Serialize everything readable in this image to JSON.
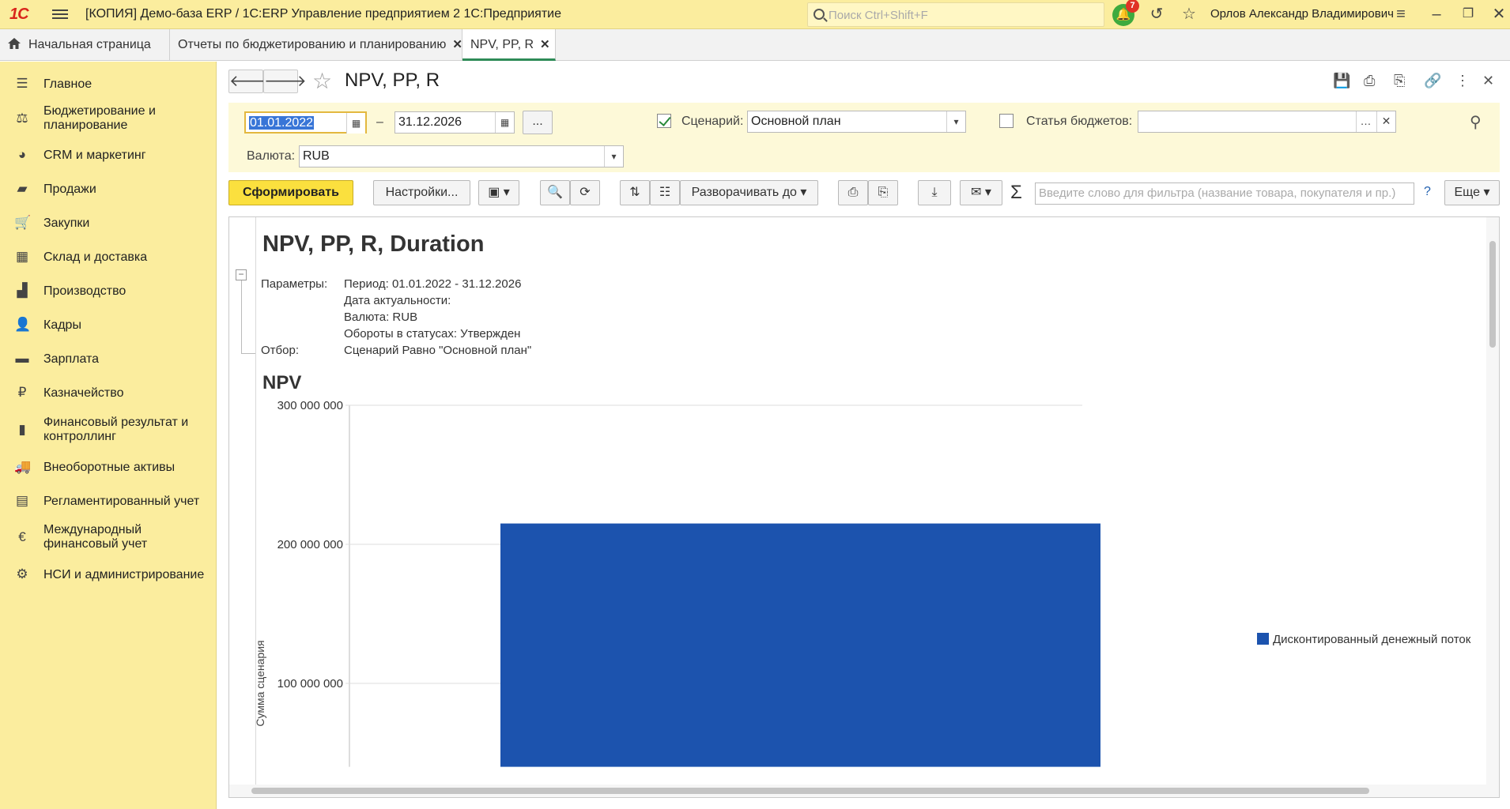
{
  "app": {
    "logo": "1С",
    "title": "[КОПИЯ] Демо-база ERP / 1С:ERP Управление предприятием 2 1С:Предприятие",
    "search_placeholder": "Поиск Ctrl+Shift+F",
    "notifications_count": "7",
    "user_name": "Орлов Александр Владимирович"
  },
  "tabs": [
    {
      "label": "Начальная страница"
    },
    {
      "label": "Отчеты по бюджетированию и планированию"
    },
    {
      "label": "NPV, PP, R"
    }
  ],
  "sidebar": {
    "items": [
      {
        "label": "Главное",
        "icon": "menu-icon"
      },
      {
        "label": "Бюджетирование и планирование",
        "icon": "budget-icon"
      },
      {
        "label": "CRM и маркетинг",
        "icon": "pie-icon"
      },
      {
        "label": "Продажи",
        "icon": "bag-icon"
      },
      {
        "label": "Закупки",
        "icon": "cart-icon"
      },
      {
        "label": "Склад и доставка",
        "icon": "grid-icon"
      },
      {
        "label": "Производство",
        "icon": "factory-icon"
      },
      {
        "label": "Кадры",
        "icon": "person-icon"
      },
      {
        "label": "Зарплата",
        "icon": "card-icon"
      },
      {
        "label": "Казначейство",
        "icon": "ruble-icon"
      },
      {
        "label": "Финансовый результат и контроллинг",
        "icon": "bar-chart-icon"
      },
      {
        "label": "Внеоборотные активы",
        "icon": "truck-icon"
      },
      {
        "label": "Регламентированный учет",
        "icon": "calculator-icon"
      },
      {
        "label": "Международный финансовый учет",
        "icon": "euro-icon"
      },
      {
        "label": "НСИ и администрирование",
        "icon": "gear-icon"
      }
    ]
  },
  "form": {
    "title": "NPV, PP, R",
    "date_from": "01.01.2022",
    "date_to": "31.12.2026",
    "dash": "–",
    "ellipsis": "...",
    "scenario_label": "Сценарий:",
    "scenario_checked": true,
    "scenario_value": "Основной план",
    "budget_item_label": "Статья бюджетов:",
    "budget_item_checked": false,
    "budget_item_value": "",
    "currency_label": "Валюта:",
    "currency_value": "RUB"
  },
  "toolbar": {
    "generate_label": "Сформировать",
    "settings_label": "Настройки...",
    "expand_label": "Разворачивать до",
    "filter_placeholder": "Введите слово для фильтра (название товара, покупателя и пр.)",
    "help_label": "?",
    "more_label": "Еще"
  },
  "report": {
    "title": "NPV, PP, R, Duration",
    "params_label": "Параметры:",
    "params": [
      "Период: 01.01.2022 - 31.12.2026",
      "Дата актуальности:",
      "Валюта: RUB",
      "Обороты в статусах: Утвержден"
    ],
    "filter_label": "Отбор:",
    "filter_value": "Сценарий Равно \"Основной план\"",
    "section_heading": "NPV"
  },
  "chart_data": {
    "type": "bar",
    "categories": [
      ""
    ],
    "series": [
      {
        "name": "Дисконтированный денежный поток",
        "values": [
          215000000
        ],
        "color": "#1c53ae"
      }
    ],
    "ylabel": "Сумма сценария",
    "ticks": [
      100000000,
      200000000,
      300000000
    ],
    "tick_labels": [
      "100 000 000",
      "200 000 000",
      "300 000 000"
    ],
    "ylim": [
      40000000,
      300000000
    ],
    "grid": true,
    "legend": "right"
  }
}
